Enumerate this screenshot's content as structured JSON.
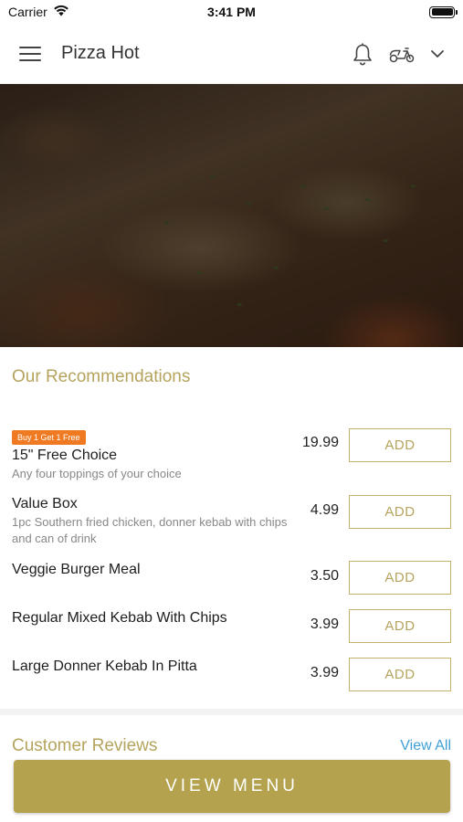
{
  "status_bar": {
    "carrier": "Carrier",
    "time": "3:41 PM"
  },
  "header": {
    "title": "Pizza Hot",
    "icons": [
      "menu-icon",
      "bell-icon",
      "scooter-icon",
      "chevron-down-icon"
    ]
  },
  "recommendations": {
    "title": "Our Recommendations",
    "items": [
      {
        "badge": "Buy 1 Get 1 Free",
        "name": "15\" Free Choice",
        "description": "Any four toppings of your choice",
        "price": "19.99",
        "button": "ADD"
      },
      {
        "name": "Value Box",
        "description": "1pc Southern fried chicken, donner kebab with chips and can of drink",
        "price": "4.99",
        "button": "ADD"
      },
      {
        "name": "Veggie Burger Meal",
        "price": "3.50",
        "button": "ADD"
      },
      {
        "name": "Regular Mixed Kebab With Chips",
        "price": "3.99",
        "button": "ADD"
      },
      {
        "name": "Large Donner Kebab In Pitta",
        "price": "3.99",
        "button": "ADD"
      }
    ]
  },
  "reviews": {
    "title": "Customer Reviews",
    "view_all": "View All"
  },
  "footer": {
    "view_menu": "VIEW MENU"
  },
  "colors": {
    "accent": "#b5a24e",
    "badge": "#ef7a22",
    "link": "#3fa0d6"
  }
}
